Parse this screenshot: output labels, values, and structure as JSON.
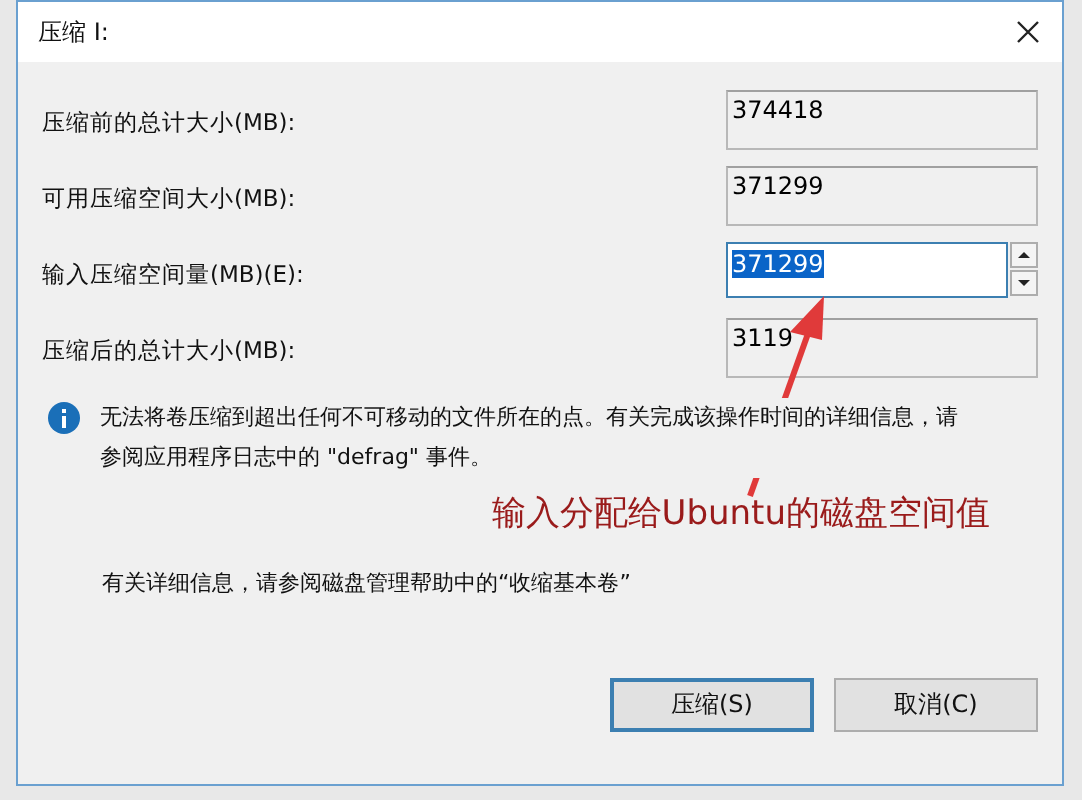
{
  "window": {
    "title": "压缩 I:"
  },
  "fields": [
    {
      "label": "压缩前的总计大小(MB):",
      "value": "374418",
      "kind": "readonly"
    },
    {
      "label": "可用压缩空间大小(MB):",
      "value": "371299",
      "kind": "readonly"
    },
    {
      "label": "输入压缩空间量(MB)(E):",
      "value": "371299",
      "kind": "spin",
      "selected": true
    },
    {
      "label": "压缩后的总计大小(MB):",
      "value": "3119",
      "kind": "readonly"
    }
  ],
  "info": {
    "lines": [
      "无法将卷压缩到超出任何不可移动的文件所在的点。有关完成该操作时间的详细信息，请",
      "参阅应用程序日志中的 \"defrag\" 事件。"
    ]
  },
  "annotation": {
    "text": "输入分配给Ubuntu的磁盘空间值"
  },
  "note": "有关详细信息，请参阅磁盘管理帮助中的“收缩基本卷”",
  "buttons": [
    {
      "label": "压缩(S)",
      "selected": true
    },
    {
      "label": "取消(C)",
      "selected": false
    }
  ]
}
